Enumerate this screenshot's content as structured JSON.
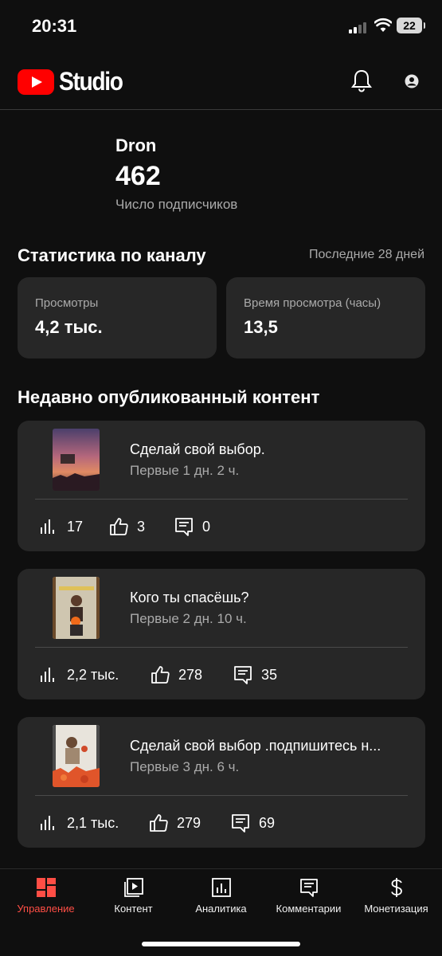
{
  "status_bar": {
    "time": "20:31",
    "battery": "22"
  },
  "header": {
    "brand": "Studio",
    "icons": [
      "bell-icon",
      "account-icon"
    ]
  },
  "channel": {
    "name": "Dron",
    "subscribers": "462",
    "subscribers_label": "Число подписчиков"
  },
  "stats": {
    "title": "Статистика по каналу",
    "period": "Последние 28 дней",
    "cards": [
      {
        "label": "Просмотры",
        "value": "4,2 тыс."
      },
      {
        "label": "Время просмотра (часы)",
        "value": "13,5"
      }
    ]
  },
  "recent": {
    "title": "Недавно опубликованный контент",
    "items": [
      {
        "title": "Сделай свой выбор.",
        "age": "Первые 1 дн. 2 ч.",
        "views": "17",
        "likes": "3",
        "comments": "0"
      },
      {
        "title": "Кого ты спасёшь?",
        "age": "Первые 2 дн. 10 ч.",
        "views": "2,2 тыс.",
        "likes": "278",
        "comments": "35"
      },
      {
        "title": "Сделай свой выбор .подпишитесь н...",
        "age": "Первые 3 дн. 6 ч.",
        "views": "2,1 тыс.",
        "likes": "279",
        "comments": "69"
      }
    ]
  },
  "bottom_nav": [
    {
      "label": "Управление",
      "icon": "dashboard-icon",
      "active": true
    },
    {
      "label": "Контент",
      "icon": "content-icon",
      "active": false
    },
    {
      "label": "Аналитика",
      "icon": "analytics-icon",
      "active": false
    },
    {
      "label": "Комментарии",
      "icon": "comments-icon",
      "active": false
    },
    {
      "label": "Монетизация",
      "icon": "monetization-icon",
      "active": false
    }
  ],
  "colors": {
    "accent": "#ff4e45",
    "brand_red": "#ff0000",
    "card": "#272727",
    "background": "#0f0f0f"
  }
}
